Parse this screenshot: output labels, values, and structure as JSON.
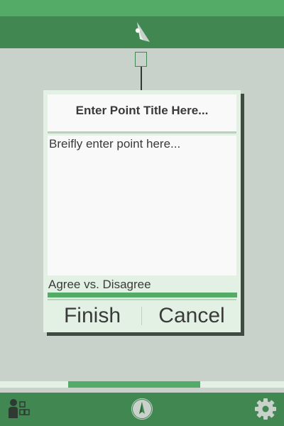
{
  "app": {
    "logo_icon": "feather-logo-icon",
    "colors": {
      "primary_light": "#54ab68",
      "primary_dark": "#418752",
      "background": "#c8d1ca",
      "card": "#e3f1e4",
      "text": "#3a3a3a"
    }
  },
  "dialog": {
    "title_placeholder": "Enter Point Title Here...",
    "body_placeholder": "Breifly enter point here...",
    "agree_label": "Agree vs. Disagree",
    "agree_value": 1.0,
    "finish_label": "Finish",
    "cancel_label": "Cancel"
  },
  "page_progress": {
    "start": 0.24,
    "end": 0.705
  },
  "bottom_nav": {
    "left_icon": "user-map-icon",
    "center_icon": "compass-icon",
    "right_icon": "gear-icon"
  }
}
